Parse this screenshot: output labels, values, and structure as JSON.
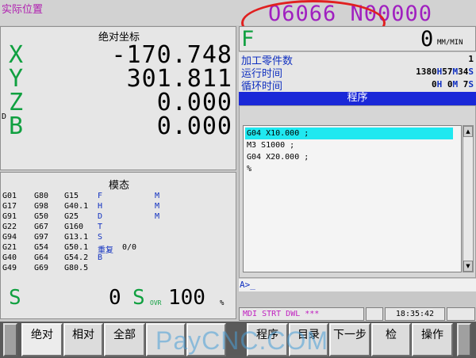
{
  "header": {
    "title": "实际位置",
    "program": "O6066 N00000"
  },
  "coord": {
    "title": "绝对坐标",
    "axes": [
      {
        "name": "X",
        "value": "-170.748"
      },
      {
        "name": "Y",
        "value": "301.811"
      },
      {
        "name": "Z",
        "value": "0.000"
      },
      {
        "name": "B",
        "value": "0.000"
      }
    ],
    "marker": "D"
  },
  "modal": {
    "title": "模态",
    "rows": [
      [
        "G01",
        "G80",
        "G15",
        "F",
        "",
        "M"
      ],
      [
        "G17",
        "G98",
        "G40.1",
        "H",
        "",
        "M"
      ],
      [
        "G91",
        "G50",
        "G25",
        "D",
        "",
        "M"
      ],
      [
        "G22",
        "G67",
        "G160",
        "T",
        "",
        ""
      ],
      [
        "G94",
        "G97",
        "G13.1",
        "S",
        "",
        ""
      ],
      [
        "G21",
        "G54",
        "G50.1",
        "重复",
        "0/0",
        ""
      ],
      [
        "G40",
        "G64",
        "G54.2",
        "B",
        "",
        ""
      ],
      [
        "G49",
        "G69",
        "G80.5",
        "",
        "",
        ""
      ]
    ],
    "spindle_label": "S",
    "spindle_value": "0",
    "sovr_label": "S",
    "sovr_sub": "OVR",
    "sovr_value": "100",
    "sovr_unit": "%"
  },
  "feed": {
    "label": "F",
    "value": "0",
    "unit": "MM/MIN"
  },
  "info": {
    "parts_label": "加工零件数",
    "parts_value": "1",
    "run_label": "运行时间",
    "run_h": "1380",
    "run_m": "57",
    "run_s": "34",
    "cycle_label": "循环时间",
    "cycle_h": "0",
    "cycle_m": "0",
    "cycle_s": "7",
    "unit_h": "H",
    "unit_m": "M",
    "unit_s": "S"
  },
  "program": {
    "header": "程序",
    "lines": [
      "G04 X10.000 ;",
      "M3 S1000 ;",
      "G04 X20.000 ;",
      "%"
    ]
  },
  "cmd": {
    "prompt": "A>_"
  },
  "status": {
    "mode": "MDI  STRT DWL ***",
    "time": "18:35:42"
  },
  "softkeys": {
    "abs": "绝对",
    "rel": "相对",
    "all": "全部",
    "prog": "程序",
    "dir": "目录",
    "next": "下一步",
    "k9": "检",
    "k10": "操作"
  },
  "watermark": "PayCNC.COM"
}
